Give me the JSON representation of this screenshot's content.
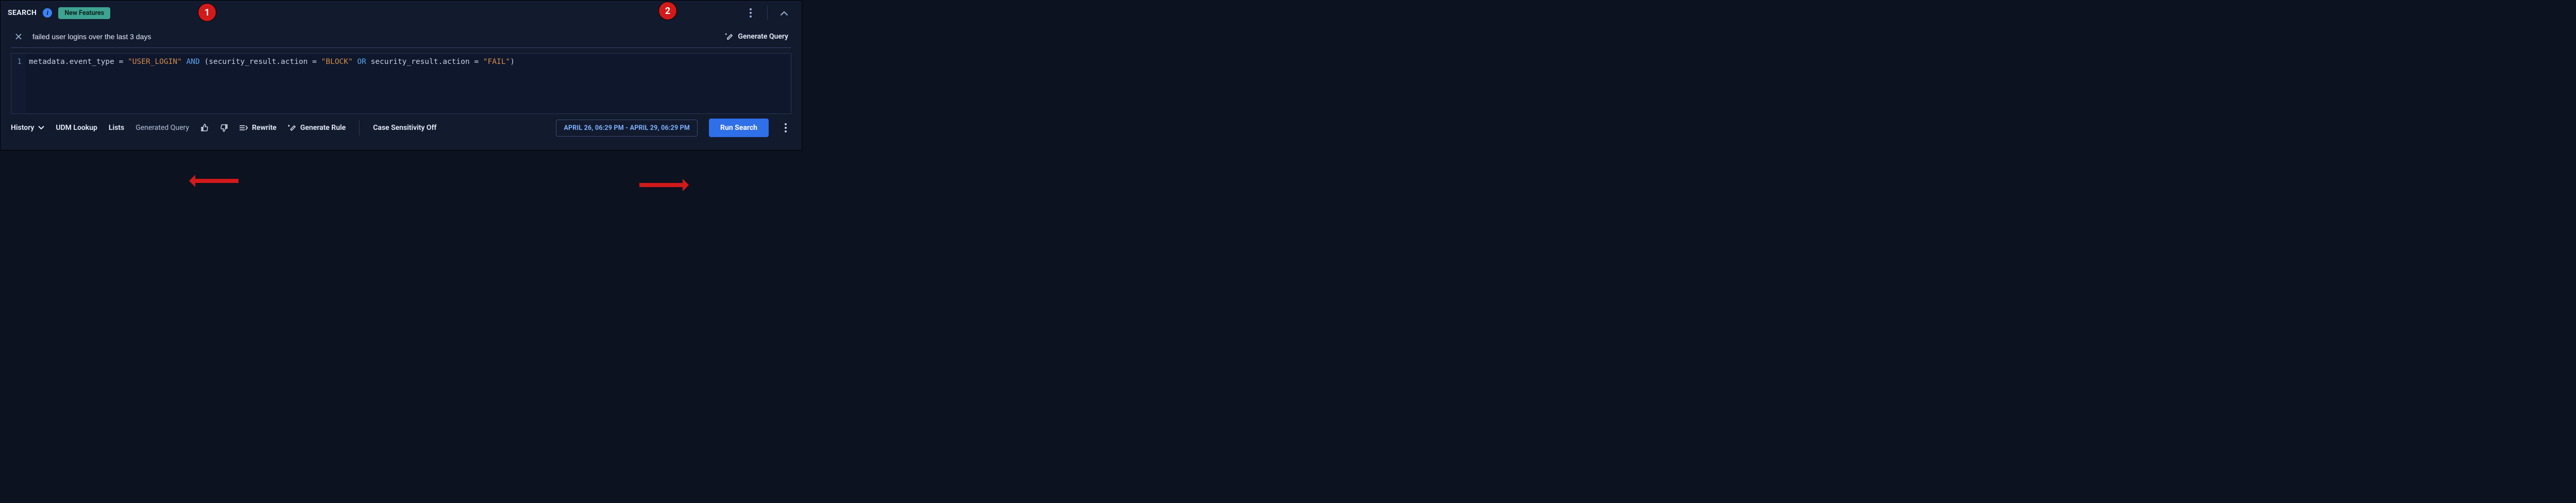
{
  "header": {
    "title": "SEARCH",
    "new_features_label": "New Features"
  },
  "nl": {
    "query_text": "failed user logins over the last 3 days",
    "generate_label": "Generate Query"
  },
  "editor": {
    "line_no": "1",
    "tokens": {
      "field1": "metadata.event_type",
      "eq": " = ",
      "str1": "\"USER_LOGIN\"",
      "and": " AND ",
      "lp": "(",
      "field2": "security_result.action",
      "str2": "\"BLOCK\"",
      "or": " OR ",
      "field3": "security_result.action",
      "str3": "\"FAIL\"",
      "rp": ")"
    }
  },
  "bottombar": {
    "history": "History",
    "udm_lookup": "UDM Lookup",
    "lists": "Lists",
    "generated_query": "Generated Query",
    "rewrite": "Rewrite",
    "generate_rule": "Generate Rule",
    "case_sensitivity": "Case Sensitivity Off",
    "time_range": "APRIL 26, 06:29 PM - APRIL 29, 06:29 PM",
    "run_search": "Run Search"
  },
  "annotations": {
    "badge1": "1",
    "badge2": "2"
  }
}
